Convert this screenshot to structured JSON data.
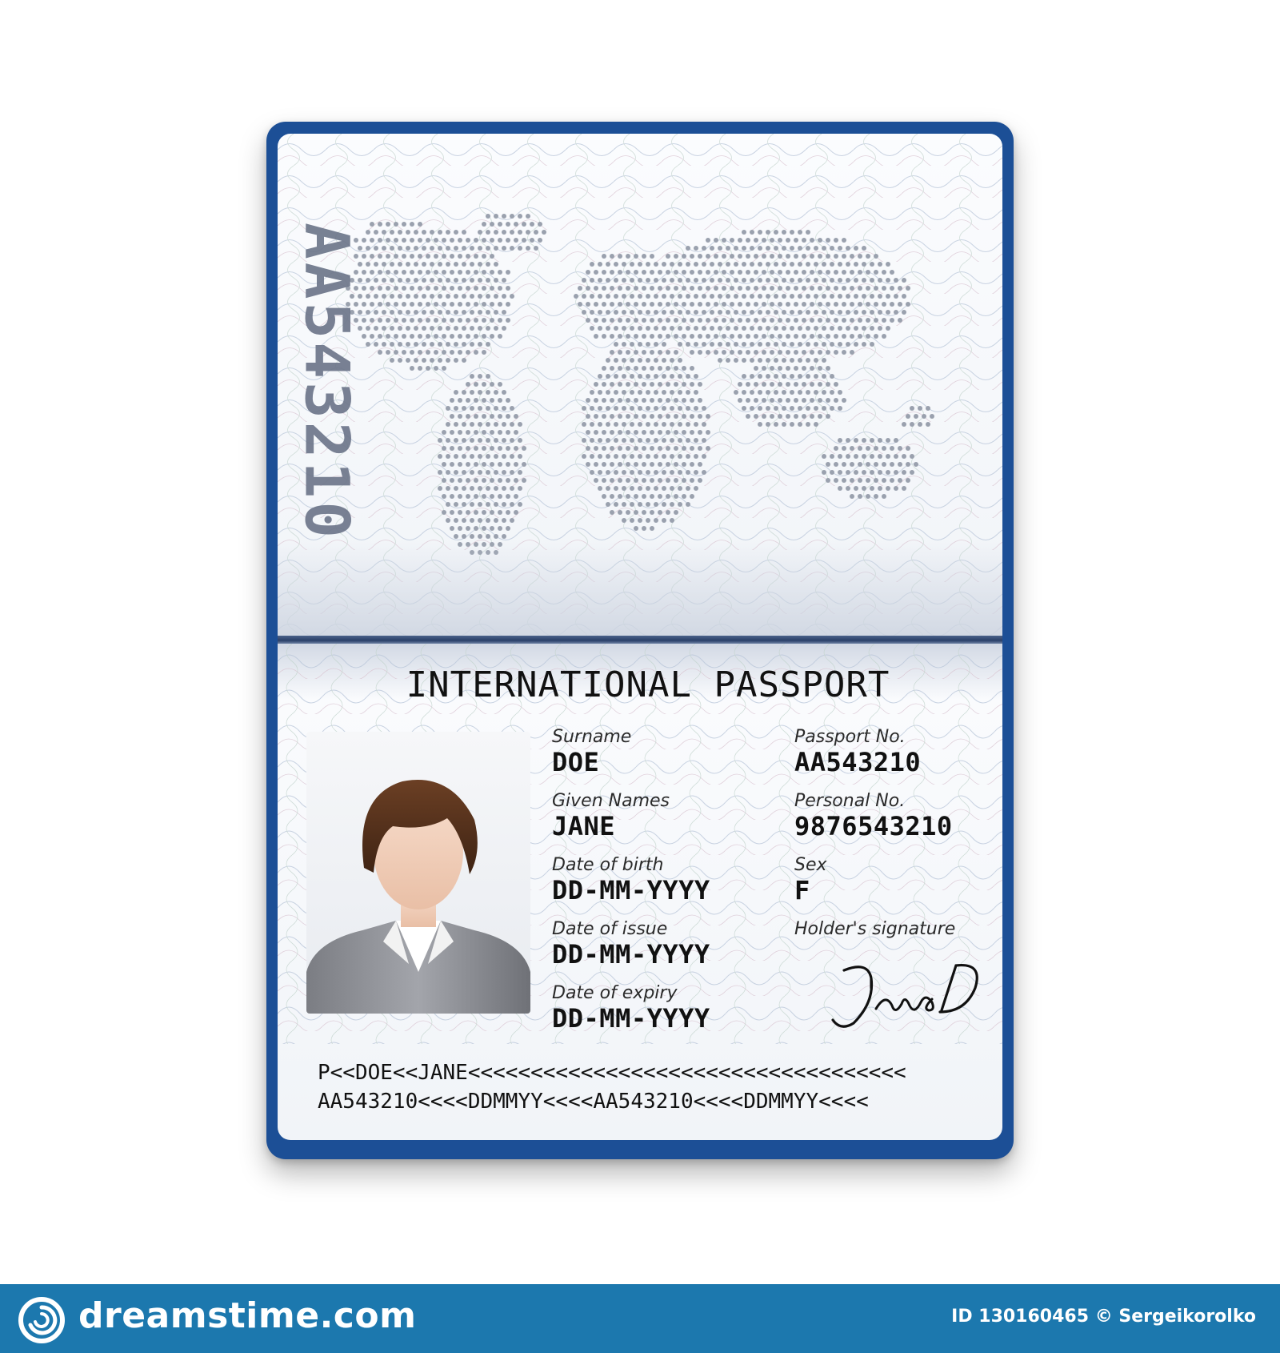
{
  "passport": {
    "vertical_number": "AA543210",
    "title": "INTERNATIONAL PASSPORT",
    "fields": {
      "surname": {
        "label": "Surname",
        "value": "DOE"
      },
      "given_names": {
        "label": "Given Names",
        "value": "JANE"
      },
      "date_of_birth": {
        "label": "Date of birth",
        "value": "DD-MM-YYYY"
      },
      "date_of_issue": {
        "label": "Date of issue",
        "value": "DD-MM-YYYY"
      },
      "date_of_expiry": {
        "label": "Date of expiry",
        "value": "DD-MM-YYYY"
      },
      "passport_no": {
        "label": "Passport No.",
        "value": "AA543210"
      },
      "personal_no": {
        "label": "Personal No.",
        "value": "9876543210"
      },
      "sex": {
        "label": "Sex",
        "value": "F"
      },
      "signature": {
        "label": "Holder's signature",
        "value": "Jane D"
      }
    },
    "mrz": [
      "P<<DOE<<JANE<<<<<<<<<<<<<<<<<<<<<<<<<<<<<<<<<<<",
      "AA543210<<<<DDMMYY<<<<AA543210<<<<DDMMYY<<<<"
    ]
  },
  "footer": {
    "brand": "dreamstime.com",
    "id_text": "ID 130160465 © Sergeikorolko"
  },
  "colors": {
    "cover": "#1c4f96",
    "footer": "#1c78ae",
    "map_dots": "#9aa1ae"
  },
  "icons": [
    "dreamstime-logo-icon",
    "avatar-icon"
  ]
}
